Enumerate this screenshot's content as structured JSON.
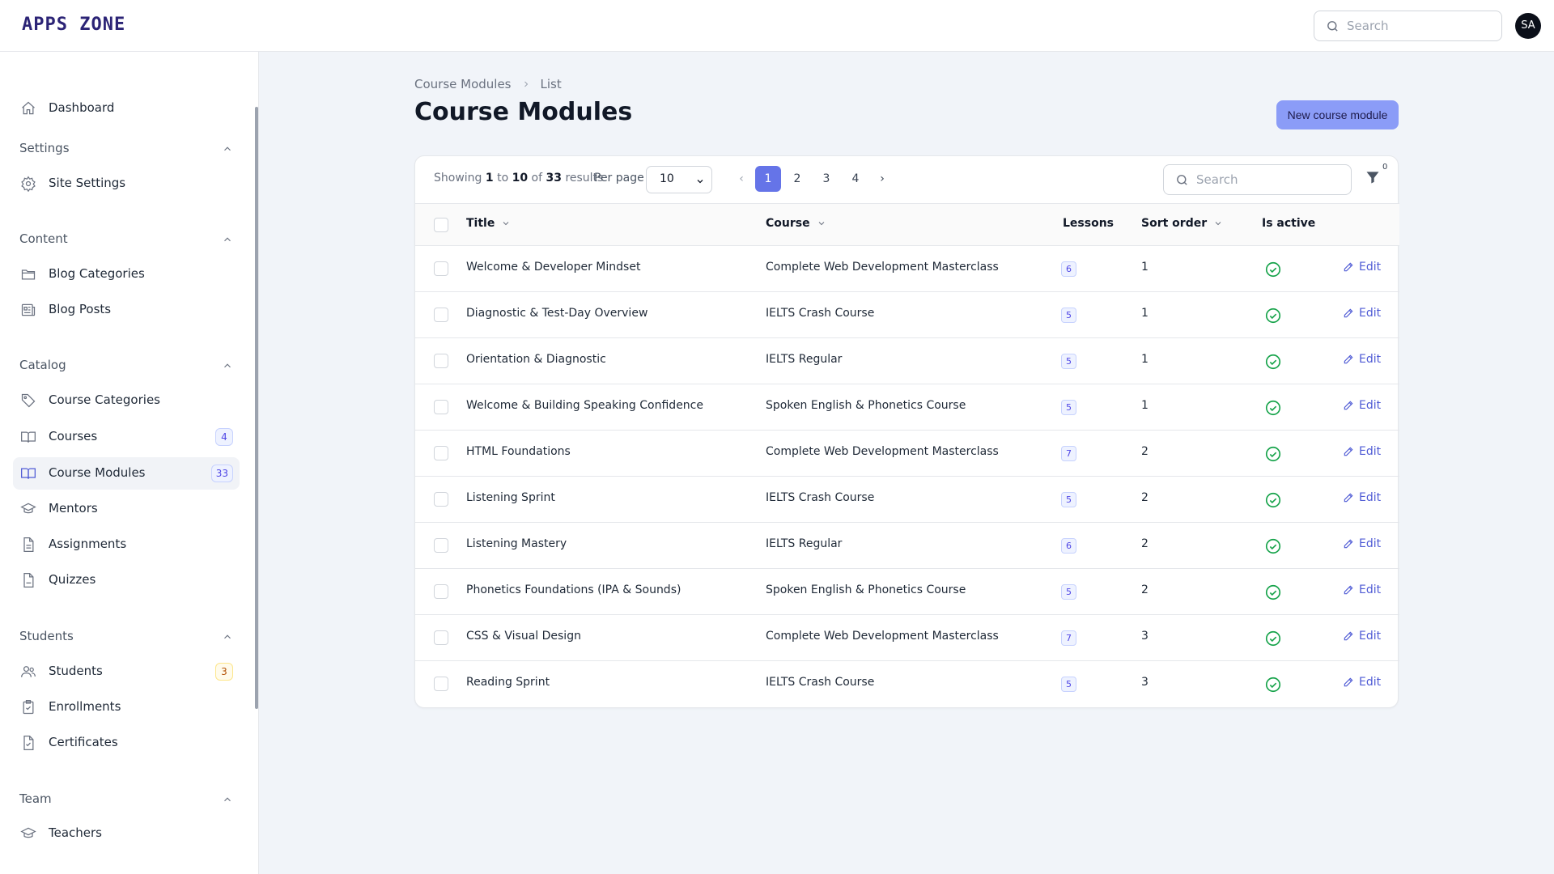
{
  "app": {
    "logo": "APPS ZONE",
    "search_placeholder": "Search",
    "avatar_initials": "SA"
  },
  "sidebar": {
    "dashboard": "Dashboard",
    "groups": {
      "settings": "Settings",
      "content": "Content",
      "catalog": "Catalog",
      "students": "Students",
      "team": "Team"
    },
    "items": {
      "site_settings": "Site Settings",
      "blog_categories": "Blog Categories",
      "blog_posts": "Blog Posts",
      "course_categories": "Course Categories",
      "courses": "Courses",
      "courses_badge": "4",
      "course_modules": "Course Modules",
      "course_modules_badge": "33",
      "mentors": "Mentors",
      "assignments": "Assignments",
      "quizzes": "Quizzes",
      "students": "Students",
      "students_badge": "3",
      "enrollments": "Enrollments",
      "certificates": "Certificates",
      "teachers": "Teachers"
    }
  },
  "page": {
    "breadcrumb": [
      "Course Modules",
      "List"
    ],
    "title": "Course Modules",
    "new_button": "New course module"
  },
  "table": {
    "showing": {
      "prefix": "Showing",
      "from": "1",
      "to_word": "to",
      "to": "10",
      "of_word": "of",
      "total": "33",
      "suffix": "results"
    },
    "per_page_label": "Per page",
    "per_page_value": "10",
    "pages": [
      "1",
      "2",
      "3",
      "4"
    ],
    "current_page": "1",
    "search_placeholder": "Search",
    "filter_count": "0",
    "columns": {
      "title": "Title",
      "course": "Course",
      "lessons": "Lessons",
      "sort_order": "Sort order",
      "is_active": "Is active"
    },
    "edit_label": "Edit",
    "rows": [
      {
        "title": "Welcome & Developer Mindset",
        "course": "Complete Web Development Masterclass",
        "lessons": "6",
        "sort": "1"
      },
      {
        "title": "Diagnostic & Test-Day Overview",
        "course": "IELTS Crash Course",
        "lessons": "5",
        "sort": "1"
      },
      {
        "title": "Orientation & Diagnostic",
        "course": "IELTS Regular",
        "lessons": "5",
        "sort": "1"
      },
      {
        "title": "Welcome & Building Speaking Confidence",
        "course": "Spoken English & Phonetics Course",
        "lessons": "5",
        "sort": "1"
      },
      {
        "title": "HTML Foundations",
        "course": "Complete Web Development Masterclass",
        "lessons": "7",
        "sort": "2"
      },
      {
        "title": "Listening Sprint",
        "course": "IELTS Crash Course",
        "lessons": "5",
        "sort": "2"
      },
      {
        "title": "Listening Mastery",
        "course": "IELTS Regular",
        "lessons": "6",
        "sort": "2"
      },
      {
        "title": "Phonetics Foundations (IPA & Sounds)",
        "course": "Spoken English & Phonetics Course",
        "lessons": "5",
        "sort": "2"
      },
      {
        "title": "CSS & Visual Design",
        "course": "Complete Web Development Masterclass",
        "lessons": "7",
        "sort": "3"
      },
      {
        "title": "Reading Sprint",
        "course": "IELTS Crash Course",
        "lessons": "5",
        "sort": "3"
      }
    ]
  },
  "colors": {
    "primary": "#6574e8",
    "active_green": "#16a34a",
    "logo": "#2c2476"
  }
}
